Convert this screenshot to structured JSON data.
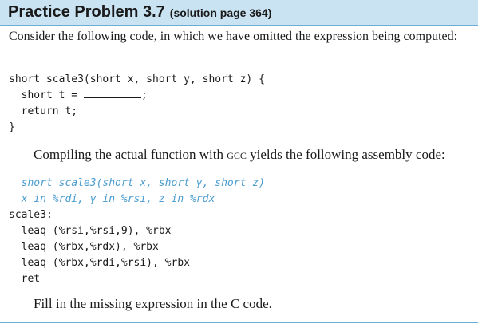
{
  "header": {
    "title": "Practice Problem 3.7",
    "subtitle": "(solution page 364)",
    "background_color": "#c9e3f2",
    "rule_color": "#6aaed6"
  },
  "intro_text": "Consider the following code, in which we have omitted the expression being computed:",
  "c_code": {
    "line1": "short scale3(short x, short y, short z) {",
    "line2_prefix": "  short t = ",
    "line2_suffix": ";",
    "line3": "  return t;",
    "line4": "}"
  },
  "middle_text": {
    "before": "Compiling the actual function with ",
    "compiler": "gcc",
    "after": " yields the following assembly code:"
  },
  "asm": {
    "comment_color": "#4a9cd0",
    "comment1": "  short scale3(short x, short y, short z)",
    "comment2": "  x in %rdi, y in %rsi, z in %rdx",
    "label": "scale3:",
    "instr1": "  leaq (%rsi,%rsi,9), %rbx",
    "instr2": "  leaq (%rbx,%rdx), %rbx",
    "instr3": "  leaq (%rbx,%rdi,%rsi), %rbx",
    "instr4": "  ret"
  },
  "closing_text": "Fill in the missing expression in the C code."
}
